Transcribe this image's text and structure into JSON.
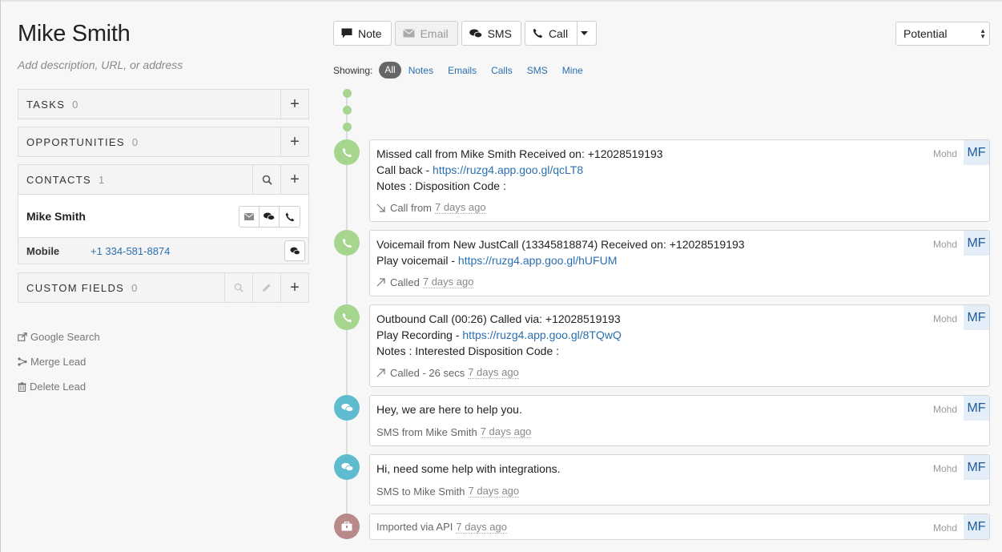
{
  "lead": {
    "name": "Mike Smith",
    "description_placeholder": "Add description, URL, or address"
  },
  "panels": {
    "tasks": {
      "title": "TASKS",
      "count": "0"
    },
    "opportunities": {
      "title": "OPPORTUNITIES",
      "count": "0"
    },
    "contacts": {
      "title": "CONTACTS",
      "count": "1"
    },
    "custom_fields": {
      "title": "CUSTOM FIELDS",
      "count": "0"
    }
  },
  "contact": {
    "name": "Mike Smith",
    "phone_label": "Mobile",
    "phone": "+1 334-581-8874"
  },
  "side_links": {
    "google": "Google Search",
    "merge": "Merge Lead",
    "delete": "Delete Lead"
  },
  "toolbar": {
    "note": "Note",
    "email": "Email",
    "sms": "SMS",
    "call": "Call"
  },
  "status": {
    "selected": "Potential"
  },
  "filters": {
    "label": "Showing:",
    "all": "All",
    "notes": "Notes",
    "emails": "Emails",
    "calls": "Calls",
    "sms": "SMS",
    "mine": "Mine"
  },
  "activities": [
    {
      "type": "call",
      "line1": "Missed call from Mike Smith Received on: +12028519193",
      "line2_prefix": "Call back - ",
      "line2_link": "https://ruzg4.app.goo.gl/qcLT8",
      "line3": "Notes : Disposition Code :",
      "meta": "Call from",
      "ago": "7 days ago",
      "owner": "Mohd",
      "initials": "MF"
    },
    {
      "type": "call",
      "line1": "Voicemail from New JustCall (13345818874) Received on: +12028519193",
      "line2_prefix": "Play voicemail - ",
      "line2_link": "https://ruzg4.app.goo.gl/hUFUM",
      "meta": "Called",
      "ago": "7 days ago",
      "owner": "Mohd",
      "initials": "MF"
    },
    {
      "type": "call",
      "line1": "Outbound Call (00:26) Called via: +12028519193",
      "line2_prefix": "Play Recording - ",
      "line2_link": "https://ruzg4.app.goo.gl/8TQwQ",
      "line3": "Notes : Interested Disposition Code :",
      "meta": "Called - 26 secs",
      "ago": "7 days ago",
      "owner": "Mohd",
      "initials": "MF"
    },
    {
      "type": "sms",
      "line1": "Hey, we are here to help you.",
      "meta": "SMS from Mike Smith",
      "ago": "7 days ago",
      "owner": "Mohd",
      "initials": "MF"
    },
    {
      "type": "sms",
      "line1": "Hi, need some help with integrations.",
      "meta": "SMS to Mike Smith",
      "ago": "7 days ago",
      "owner": "Mohd",
      "initials": "MF"
    },
    {
      "type": "api",
      "meta": "Imported via API",
      "ago": "7 days ago",
      "owner": "Mohd",
      "initials": "MF"
    }
  ],
  "colors": {
    "link": "#2a6fb0",
    "call": "#a6d58d",
    "sms": "#5fbcce",
    "api": "#b98a8a",
    "initials_bg": "#e3eef8"
  }
}
